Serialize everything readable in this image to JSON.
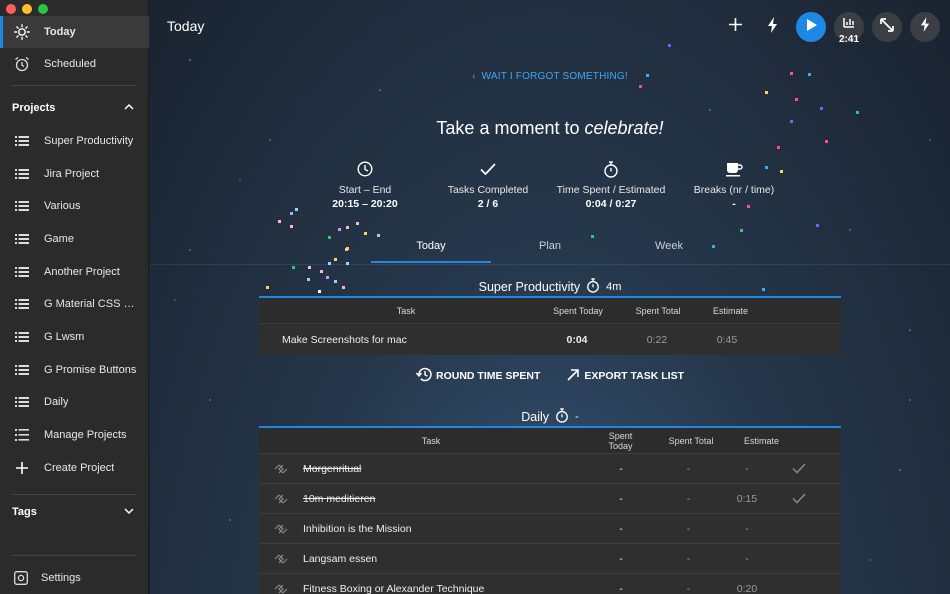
{
  "sidebar": {
    "today": "Today",
    "scheduled": "Scheduled",
    "projects_title": "Projects",
    "projects": [
      "Super Productivity",
      "Jira Project",
      "Various",
      "Game",
      "Another Project",
      "G Material CSS Va...",
      "G Lwsm",
      "G Promise Buttons",
      "Daily"
    ],
    "manage_projects": "Manage Projects",
    "create_project": "Create Project",
    "tags_title": "Tags",
    "settings": "Settings"
  },
  "header": {
    "title": "Today",
    "timer": "2:41"
  },
  "celebration": {
    "back_link": "WAIT I FORGOT SOMETHING!",
    "title_prefix": "Take a moment to ",
    "title_em": "celebrate!"
  },
  "stats": [
    {
      "name": "Start – End",
      "value": "20:15 – 20:20"
    },
    {
      "name": "Tasks Completed",
      "value": "2 / 6"
    },
    {
      "name": "Time Spent / Estimated",
      "value": "0:04 / 0:27"
    },
    {
      "name": "Breaks (nr / time)",
      "value": "-"
    }
  ],
  "tabs": [
    "Today",
    "Plan",
    "Week"
  ],
  "project_block": {
    "title": "Super Productivity",
    "time": "4m",
    "headers": [
      "Task",
      "Spent Today",
      "Spent Total",
      "Estimate"
    ],
    "rows": [
      {
        "task": "Make Screenshots for mac",
        "today": "0:04",
        "total": "0:22",
        "estimate": "0:45"
      }
    ]
  },
  "actions": {
    "round": "ROUND TIME SPENT",
    "export": "EXPORT TASK LIST"
  },
  "daily_block": {
    "title": "Daily",
    "time": "-",
    "headers": [
      "Task",
      "Spent Today",
      "Spent Total",
      "Estimate"
    ],
    "rows": [
      {
        "task": "Morgenritual",
        "today": "-",
        "total": "-",
        "estimate": "-",
        "done": true
      },
      {
        "task": "10m meditieren",
        "today": "-",
        "total": "-",
        "estimate": "0:15",
        "done": true
      },
      {
        "task": "Inhibition is the Mission",
        "today": "-",
        "total": "-",
        "estimate": "-",
        "done": false
      },
      {
        "task": "Langsam essen",
        "today": "-",
        "total": "-",
        "estimate": "-",
        "done": false
      },
      {
        "task": "Fitness Boxing or Alexander Technique",
        "today": "-",
        "total": "-",
        "estimate": "0:20",
        "done": false
      }
    ]
  },
  "colors": {
    "accent": "#1e88e5",
    "sidebar_bg": "#2b2b2b",
    "link": "#42a5f5"
  }
}
